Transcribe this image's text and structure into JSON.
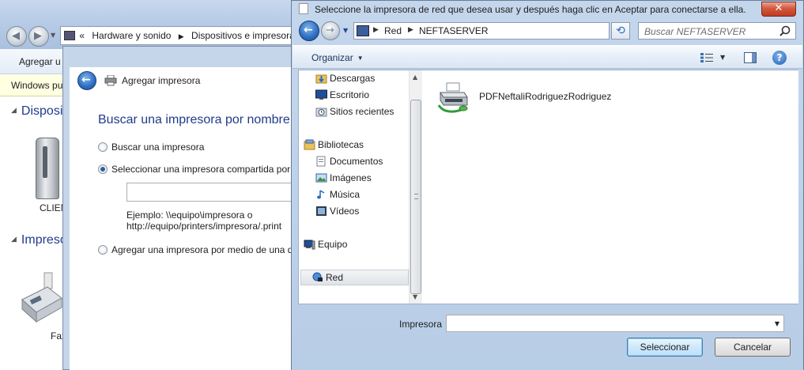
{
  "background_window": {
    "breadcrumb_prefix": "«",
    "breadcrumb": [
      "Hardware y sonido",
      "Dispositivos e impresora"
    ],
    "toolbar_action": "Agregar u",
    "infobar_text": "Windows pu",
    "group_devices": "Disposit",
    "group_printers": "Impreso",
    "device_label": "CLIEN",
    "fax_label": "Fax"
  },
  "wizard": {
    "title": "Agregar impresora",
    "heading": "Buscar una impresora por nombre",
    "options": [
      {
        "label": "Buscar una impresora",
        "selected": false
      },
      {
        "label": "Seleccionar una impresora compartida por",
        "selected": true
      },
      {
        "label": "Agregar una impresora por medio de una d",
        "selected": false
      }
    ],
    "shared_printer_value": "",
    "example_line1": "Ejemplo: \\\\equipo\\impresora o",
    "example_line2": "http://equipo/printers/impresora/.print"
  },
  "dialog": {
    "title": "Seleccione la impresora de red que desea usar y después haga clic en Aceptar para conectarse a ella.",
    "close_glyph": "✕",
    "address": [
      "Red",
      "NEFTASERVER"
    ],
    "search_placeholder": "Buscar NEFTASERVER",
    "organize_label": "Organizar",
    "nav_items": [
      {
        "label": "Descargas",
        "icon": "downloads-folder-icon"
      },
      {
        "label": "Escritorio",
        "icon": "desktop-icon"
      },
      {
        "label": "Sitios recientes",
        "icon": "recent-places-icon"
      },
      {
        "label": "Bibliotecas",
        "icon": "libraries-icon"
      },
      {
        "label": "Documentos",
        "icon": "documents-icon"
      },
      {
        "label": "Imágenes",
        "icon": "pictures-icon"
      },
      {
        "label": "Música",
        "icon": "music-icon"
      },
      {
        "label": "Vídeos",
        "icon": "videos-icon"
      },
      {
        "label": "Equipo",
        "icon": "computer-icon"
      },
      {
        "label": "Red",
        "icon": "network-icon",
        "selected": true
      }
    ],
    "printers": [
      {
        "name": "PDFNeftaliRodriguezRodriguez",
        "icon": "shared-printer-icon"
      }
    ],
    "printer_field_label": "Impresora",
    "printer_field_value": "",
    "select_button": "Seleccionar",
    "cancel_button": "Cancelar"
  },
  "colors": {
    "heading_blue": "#1e3c8c",
    "chrome_blue": "#b8cde6",
    "infobar_yellow": "#ffffe1"
  }
}
